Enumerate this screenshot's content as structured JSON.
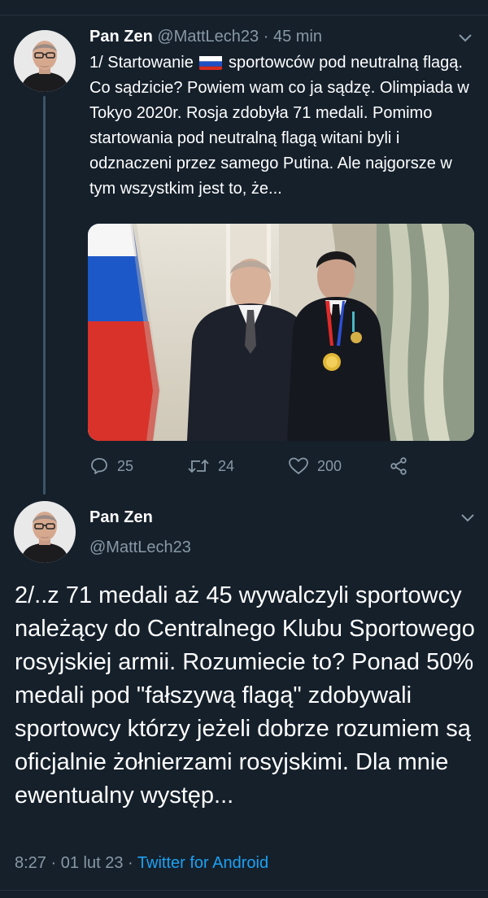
{
  "tweet1": {
    "name": "Pan Zen",
    "handle": "@MattLech23",
    "separator": "·",
    "time": "45 min",
    "text_before_flag": "1/ Startowanie",
    "flag_icon": "russia-flag-emoji",
    "text_after_flag": "sportowców pod neutralną flagą. Co sądzicie? Powiem wam co ja sądzę. Olimpiada w Tokyo 2020r. Rosja zdobyła 71 medali. Pomimo startowania pod neutralną flagą witani byli i odznaczeni przez samego Putina. Ale najgorsze w tym wszystkim jest to, że...",
    "replies": "25",
    "retweets": "24",
    "likes": "200"
  },
  "tweet2": {
    "name": "Pan Zen",
    "handle": "@MattLech23",
    "text": "2/..z 71 medali aż 45 wywalczyli sportowcy należący do Centralnego Klubu Sportowego rosyjskiej armii. Rozumiecie to? Ponad 50% medali pod \"fałszywą flagą\" zdobywali sportowcy którzy jeżeli dobrze rozumiem są oficjalnie żołnierzami rosyjskimi. Dla mnie ewentualny występ...",
    "time": "8:27",
    "separator1": "·",
    "date": "01 lut 23",
    "separator2": "·",
    "source": "Twitter for Android"
  },
  "colors": {
    "background": "#15202b",
    "muted": "#8899a6",
    "link": "#1da1f2",
    "divider": "#243340"
  }
}
